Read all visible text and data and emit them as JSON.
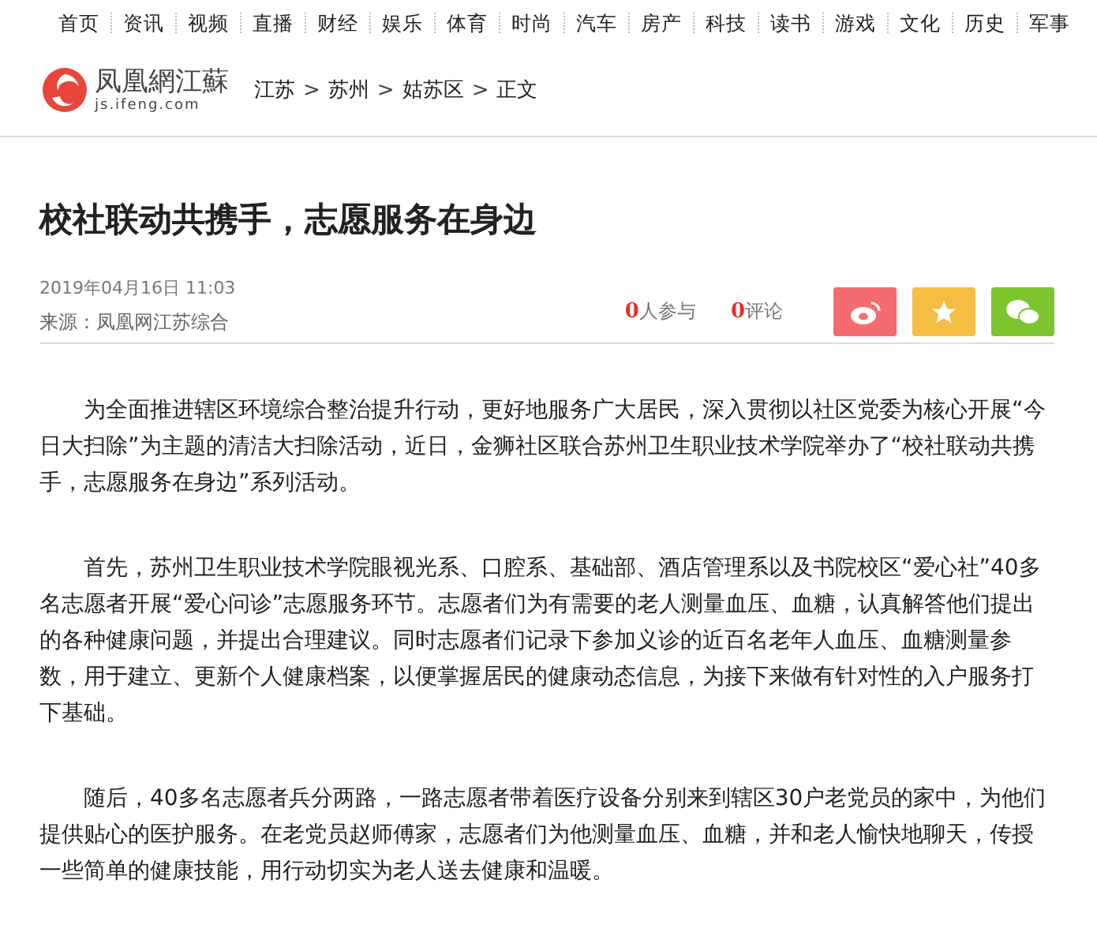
{
  "nav": [
    "首页",
    "资讯",
    "视频",
    "直播",
    "财经",
    "娱乐",
    "体育",
    "时尚",
    "汽车",
    "房产",
    "科技",
    "读书",
    "游戏",
    "文化",
    "历史",
    "军事"
  ],
  "logo": {
    "name": "凤凰網江蘇",
    "domain": "js.ifeng.com"
  },
  "breadcrumb": [
    "江苏",
    "苏州",
    "姑苏区",
    "正文"
  ],
  "separator": ">",
  "article": {
    "title": "校社联动共携手，志愿服务在身边",
    "date": "2019年04月16日  11:03",
    "source": "来源：凤凰网江苏综合",
    "stats": [
      {
        "count": "0",
        "label": "人参与"
      },
      {
        "count": "0",
        "label": "评论"
      }
    ],
    "share": [
      {
        "kind": "weibo",
        "color": "#f66b6f"
      },
      {
        "kind": "favorite",
        "color": "#f6bc43"
      },
      {
        "kind": "wechat",
        "color": "#7cc52d"
      }
    ],
    "paragraphs": [
      "为全面推进辖区环境综合整治提升行动，更好地服务广大居民，深入贯彻以社区党委为核心开展“今日大扫除”为主题的清洁大扫除活动，近日，金狮社区联合苏州卫生职业技术学院举办了“校社联动共携手，志愿服务在身边”系列活动。",
      "首先，苏州卫生职业技术学院眼视光系、口腔系、基础部、酒店管理系以及书院校区“爱心社”40多名志愿者开展“爱心问诊”志愿服务环节。志愿者们为有需要的老人测量血压、血糖，认真解答他们提出的各种健康问题，并提出合理建议。同时志愿者们记录下参加义诊的近百名老年人血压、血糖测量参数，用于建立、更新个人健康档案，以便掌握居民的健康动态信息，为接下来做有针对性的入户服务打下基础。",
      "随后，40多名志愿者兵分两路，一路志愿者带着医疗设备分别来到辖区30户老党员的家中，为他们提供贴心的医护服务。在老党员赵师傅家，志愿者们为他测量血压、血糖，并和老人愉快地聊天，传授一些简单的健康技能，用行动切实为老人送去健康和温暖。"
    ]
  }
}
